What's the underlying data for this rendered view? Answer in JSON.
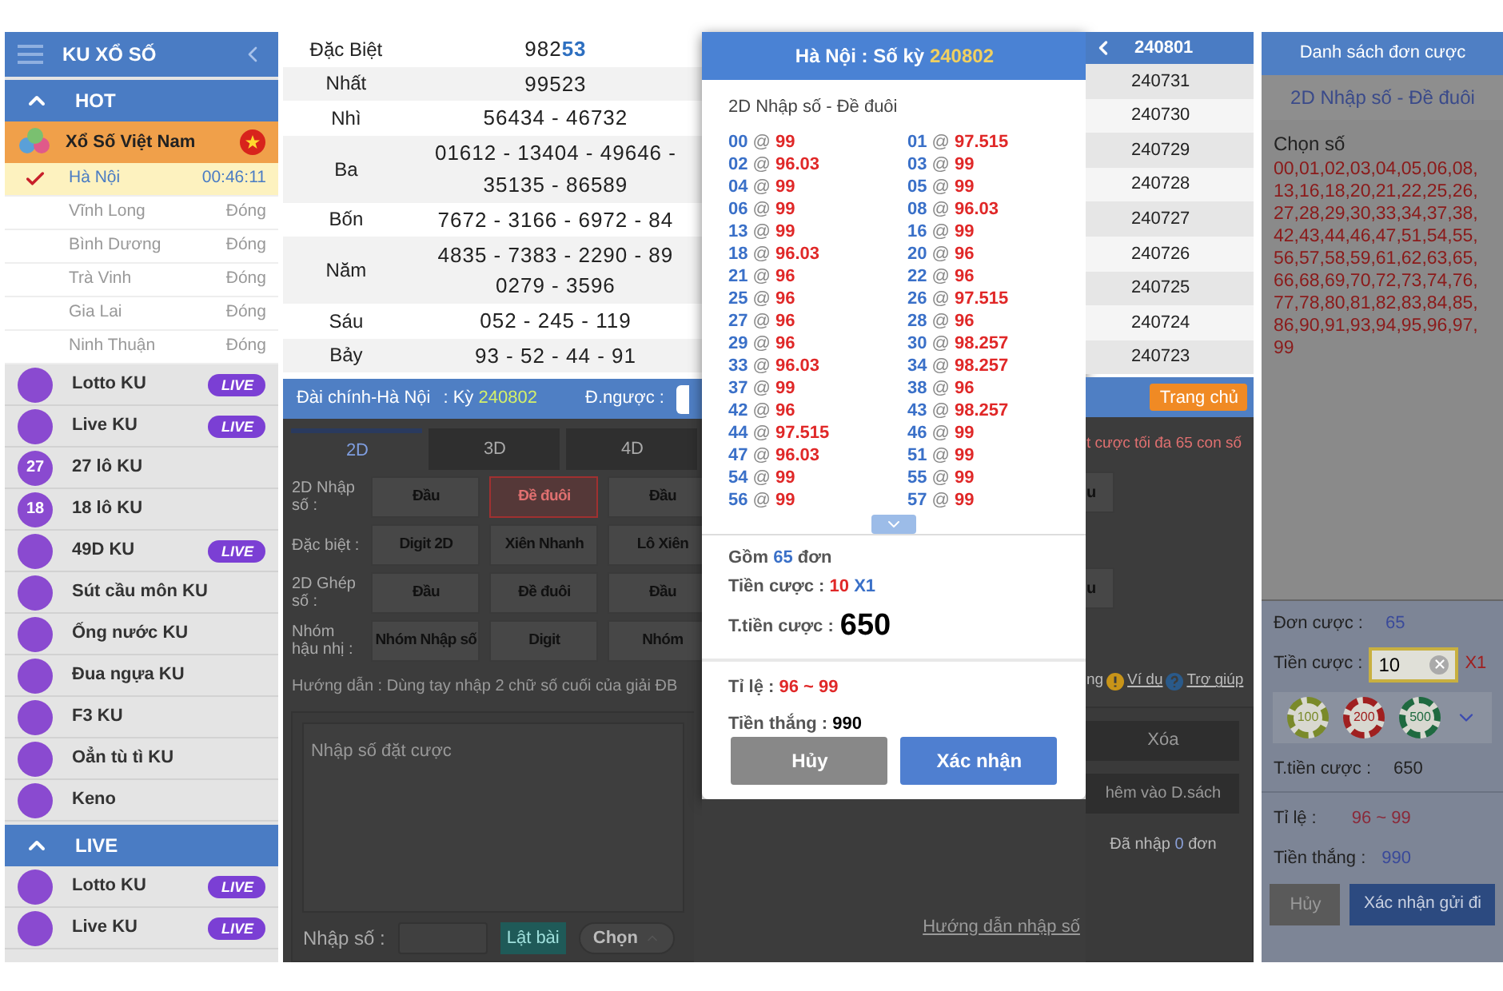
{
  "sidebar": {
    "title": "KU XỔ SỐ",
    "sections": [
      {
        "title": "HOT",
        "expanded": true,
        "items": [
          {
            "kind": "category",
            "name": "Xổ Số Việt Nam",
            "children": [
              {
                "name": "Hà Nội",
                "status": "00:46:11",
                "selected": true
              },
              {
                "name": "Vĩnh Long",
                "status": "Đóng",
                "selected": false
              },
              {
                "name": "Bình Dương",
                "status": "Đóng",
                "selected": false
              },
              {
                "name": "Trà Vinh",
                "status": "Đóng",
                "selected": false
              },
              {
                "name": "Gia Lai",
                "status": "Đóng",
                "selected": false
              },
              {
                "name": "Ninh Thuận",
                "status": "Đóng",
                "selected": false
              }
            ]
          },
          {
            "kind": "game",
            "name": "Lotto KU",
            "badge": "LIVE"
          },
          {
            "kind": "game",
            "name": "Live KU",
            "badge": "LIVE"
          },
          {
            "kind": "game",
            "name": "27 lô KU",
            "icon_label": "27"
          },
          {
            "kind": "game",
            "name": "18 lô KU",
            "icon_label": "18"
          },
          {
            "kind": "game",
            "name": "49D KU",
            "badge": "LIVE"
          },
          {
            "kind": "game",
            "name": "Sút cầu môn KU"
          },
          {
            "kind": "game",
            "name": "Ống nước KU"
          },
          {
            "kind": "game",
            "name": "Đua ngựa KU"
          },
          {
            "kind": "game",
            "name": "F3 KU"
          },
          {
            "kind": "game",
            "name": "Oẳn tù tì KU"
          },
          {
            "kind": "game",
            "name": "Keno"
          }
        ]
      },
      {
        "title": "LIVE",
        "expanded": true,
        "items": [
          {
            "kind": "game",
            "name": "Lotto KU",
            "badge": "LIVE"
          },
          {
            "kind": "game",
            "name": "Live KU",
            "badge": "LIVE"
          }
        ]
      }
    ]
  },
  "results": {
    "prizes": [
      {
        "name": "Đặc Biệt",
        "lines": [
          "982"
        ],
        "tail": "53"
      },
      {
        "name": "Nhất",
        "lines": [
          "99523"
        ]
      },
      {
        "name": "Nhì",
        "lines": [
          "56434 - 46732"
        ]
      },
      {
        "name": "Ba",
        "lines": [
          "01612 - 13404 - 49646 -",
          "35135 - 86589"
        ]
      },
      {
        "name": "Bốn",
        "lines": [
          "7672 - 3166 - 6972 - 84"
        ]
      },
      {
        "name": "Năm",
        "lines": [
          "4835 - 7383 - 2290 - 89",
          "0279 - 3596"
        ]
      },
      {
        "name": "Sáu",
        "lines": [
          "052 - 245 - 119"
        ]
      },
      {
        "name": "Bảy",
        "lines": [
          "93 - 52 - 44 - 91"
        ]
      }
    ]
  },
  "periods": {
    "current": "240801",
    "items": [
      "240731",
      "240730",
      "240729",
      "240728",
      "240727",
      "240726",
      "240725",
      "240724",
      "240723"
    ]
  },
  "info_bar": {
    "region": "Đài chính-Hà Nội",
    "period_label": ": Kỳ",
    "period": "240802",
    "countdown_label": "Đ.ngược :",
    "home_button": "Trang chủ"
  },
  "bet_form": {
    "tabs": [
      {
        "label": "2D",
        "selected": true
      },
      {
        "label": "3D",
        "selected": false
      },
      {
        "label": "4D",
        "selected": false
      }
    ],
    "limit_note": "t cược tối đa 65 con số",
    "groups": [
      {
        "label": "2D Nhập số :",
        "options": [
          {
            "label": "Đầu",
            "selected": false
          },
          {
            "label": "Đề đuôi",
            "selected": true
          },
          {
            "label": "Đầu",
            "selected": false
          }
        ],
        "overflow": "u"
      },
      {
        "label": "Đặc biệt :",
        "options": [
          {
            "label": "Digit 2D",
            "selected": false
          },
          {
            "label": "Xiên Nhanh",
            "selected": false
          },
          {
            "label": "Lô Xiên",
            "selected": false
          }
        ]
      },
      {
        "label": "2D Ghép số :",
        "options": [
          {
            "label": "Đầu",
            "selected": false
          },
          {
            "label": "Đề đuôi",
            "selected": false
          },
          {
            "label": "Đầu",
            "selected": false
          }
        ],
        "overflow": "u"
      },
      {
        "label": "Nhóm hậu nhị :",
        "options": [
          {
            "label": "Nhóm Nhập số",
            "selected": false
          },
          {
            "label": "Digit",
            "selected": false
          },
          {
            "label": "Nhóm",
            "selected": false
          }
        ]
      }
    ],
    "guide": "Hướng dẫn : Dùng tay nhập 2 chữ số cuối của giải ĐB",
    "help_prefix": "ng",
    "example_link": "Ví dụ",
    "help_link": "Trợ giúp",
    "textarea_placeholder": "Nhập số đặt cược",
    "clear_button": "Xóa",
    "add_button": "hêm vào D.sách",
    "entered": {
      "prefix": "Đã nhập",
      "count": "0",
      "suffix": "đơn"
    },
    "number_label": "Nhập số :",
    "flip_button": "Lật bài",
    "choose_button": "Chọn",
    "input_guide_link": "Hướng dẫn nhập số"
  },
  "modal": {
    "title": "Hà Nội : Số kỳ",
    "period": "240802",
    "bet_type": "2D Nhập số - Đề đuôi",
    "separator": "@",
    "bets": [
      {
        "number": "00",
        "odds": "99"
      },
      {
        "number": "01",
        "odds": "97.515"
      },
      {
        "number": "02",
        "odds": "96.03"
      },
      {
        "number": "03",
        "odds": "99"
      },
      {
        "number": "04",
        "odds": "99"
      },
      {
        "number": "05",
        "odds": "99"
      },
      {
        "number": "06",
        "odds": "99"
      },
      {
        "number": "08",
        "odds": "96.03"
      },
      {
        "number": "13",
        "odds": "99"
      },
      {
        "number": "16",
        "odds": "99"
      },
      {
        "number": "18",
        "odds": "96.03"
      },
      {
        "number": "20",
        "odds": "96"
      },
      {
        "number": "21",
        "odds": "96"
      },
      {
        "number": "22",
        "odds": "96"
      },
      {
        "number": "25",
        "odds": "96"
      },
      {
        "number": "26",
        "odds": "97.515"
      },
      {
        "number": "27",
        "odds": "96"
      },
      {
        "number": "28",
        "odds": "96"
      },
      {
        "number": "29",
        "odds": "96"
      },
      {
        "number": "30",
        "odds": "98.257"
      },
      {
        "number": "33",
        "odds": "96.03"
      },
      {
        "number": "34",
        "odds": "98.257"
      },
      {
        "number": "37",
        "odds": "99"
      },
      {
        "number": "38",
        "odds": "96"
      },
      {
        "number": "42",
        "odds": "96"
      },
      {
        "number": "43",
        "odds": "98.257"
      },
      {
        "number": "44",
        "odds": "97.515"
      },
      {
        "number": "46",
        "odds": "99"
      },
      {
        "number": "47",
        "odds": "96.03"
      },
      {
        "number": "51",
        "odds": "99"
      },
      {
        "number": "54",
        "odds": "99"
      },
      {
        "number": "55",
        "odds": "99"
      },
      {
        "number": "56",
        "odds": "99"
      },
      {
        "number": "57",
        "odds": "99"
      }
    ],
    "count_prefix": "Gồm",
    "count": "65",
    "count_suffix": "đơn",
    "stake_label": "Tiền cược :",
    "stake": "10",
    "multiplier": "X1",
    "total_label": "T.tiền cược :",
    "total": "650",
    "rate_label": "Tỉ lệ :",
    "rate": "96 ~ 99",
    "win_label": "Tiền thắng :",
    "win": "990",
    "cancel_button": "Hủy",
    "confirm_button": "Xác nhận"
  },
  "right_panel": {
    "title": "Danh sách đơn cược",
    "bet_type": "2D Nhập số - Đề đuôi",
    "numbers_label": "Chọn số",
    "number_lines": [
      "00,01,02,03,04,05,06,08,",
      "13,16,18,20,21,22,25,26,",
      "27,28,29,30,33,34,37,38,",
      "42,43,44,46,47,51,54,55,",
      "56,57,58,59,61,62,63,65,",
      "66,68,69,70,72,73,74,76,",
      "77,78,80,81,82,83,84,85,",
      "86,90,91,93,94,95,96,97,",
      "99"
    ],
    "orders_label": "Đơn cược :",
    "orders": "65",
    "stake_label": "Tiền cược :",
    "stake": "10",
    "multiplier": "X1",
    "chips": [
      {
        "label": "100",
        "color": "#7a8a2a"
      },
      {
        "label": "200",
        "color": "#a02020"
      },
      {
        "label": "500",
        "color": "#1f6a40"
      }
    ],
    "total_label": "T.tiền cược :",
    "total": "650",
    "rate_label": "Tỉ lệ :",
    "rate": "96 ~ 99",
    "win_label": "Tiền thắng :",
    "win": "990",
    "cancel_button": "Hủy",
    "submit_button": "Xác nhận gửi đi"
  }
}
